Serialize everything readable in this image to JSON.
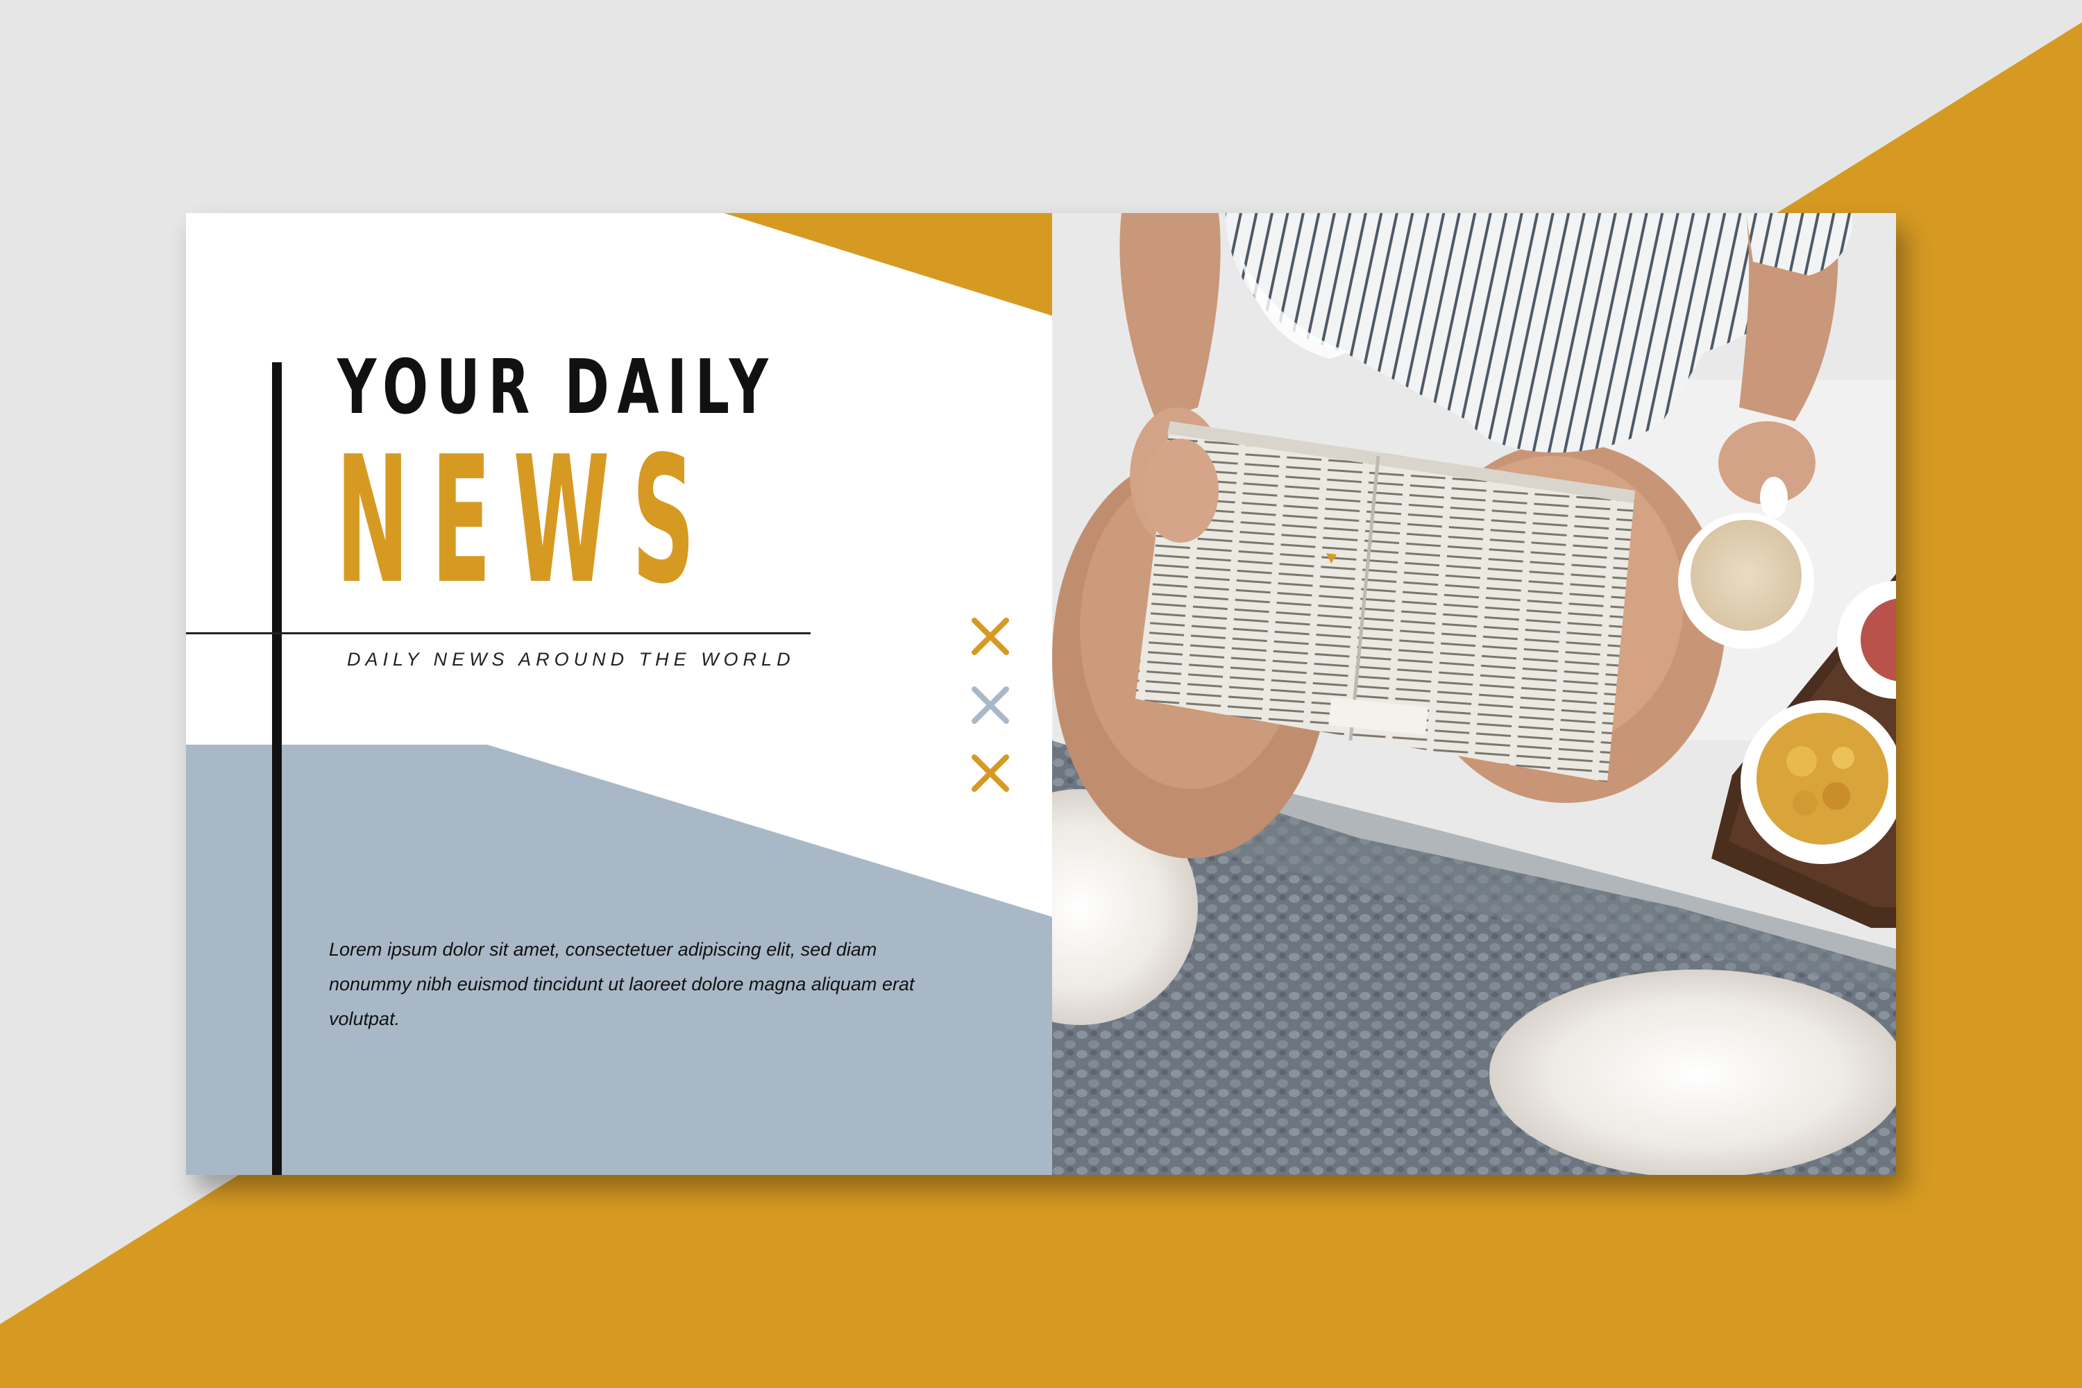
{
  "banner": {
    "title_line1": "YOUR DAILY",
    "title_line2": "NEWS",
    "subtitle": "DAILY NEWS AROUND THE WORLD",
    "body": "Lorem ipsum dolor sit amet, consectetuer adipiscing elit, sed diam nonummy nibh euismod tincidunt ut laoreet dolore magna aliquam erat volutpat."
  },
  "colors": {
    "accent": "#d69a23",
    "blue_gray": "#a8b8c6",
    "background": "#e6e6e6",
    "text": "#111111"
  },
  "decorations": {
    "crosses": [
      "cross-icon-gold",
      "cross-icon-gray",
      "cross-icon-gold"
    ]
  },
  "photo": {
    "subject": "person-reading-newspaper-photo"
  }
}
